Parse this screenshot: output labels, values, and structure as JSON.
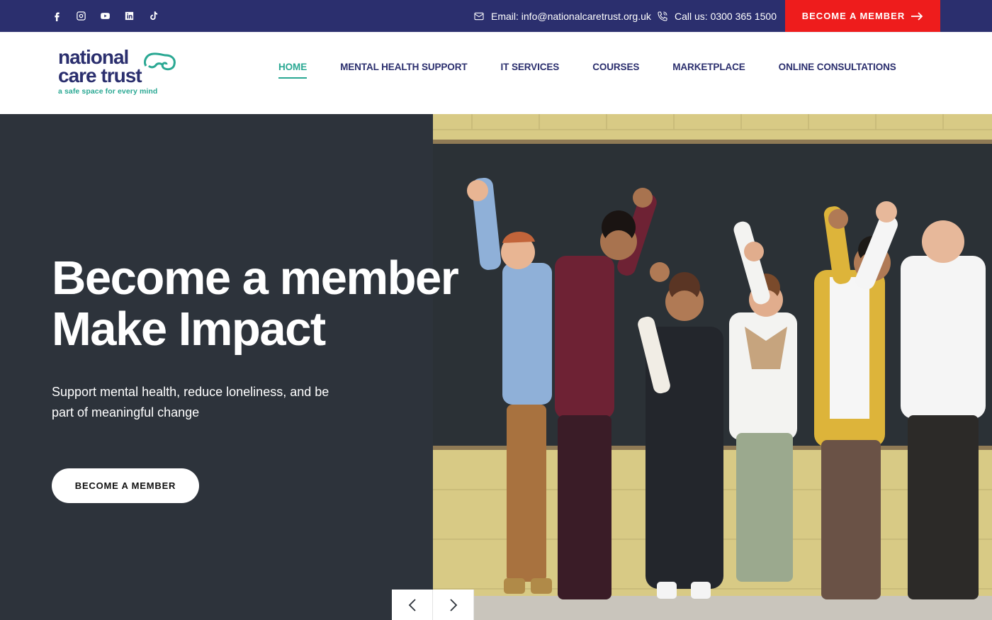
{
  "colors": {
    "topbar_bg": "#2b2f6e",
    "cta_red": "#ee1c1c",
    "accent_teal": "#2aa893",
    "hero_bg": "#2d333b"
  },
  "topbar": {
    "social_icons": [
      "facebook-icon",
      "instagram-icon",
      "youtube-icon",
      "linkedin-icon",
      "tiktok-icon"
    ],
    "email_text": "Email: info@nationalcaretrust.org.uk",
    "phone_text": "Call us: 0300 365 1500",
    "cta_label": "BECOME A MEMBER"
  },
  "logo": {
    "line1": "national",
    "line2": "care trust",
    "tagline": "a safe space for every mind"
  },
  "nav": {
    "items": [
      {
        "label": "HOME",
        "active": true
      },
      {
        "label": "MENTAL HEALTH SUPPORT",
        "active": false
      },
      {
        "label": "IT SERVICES",
        "active": false
      },
      {
        "label": "COURSES",
        "active": false
      },
      {
        "label": "MARKETPLACE",
        "active": false
      },
      {
        "label": "ONLINE CONSULTATIONS",
        "active": false
      }
    ]
  },
  "hero": {
    "headline_line1": "Become a member",
    "headline_line2": "Make Impact",
    "subtitle": "Support mental health, reduce loneliness, and be part of meaningful change",
    "button_label": "BECOME A MEMBER",
    "image_alt": "group-photo"
  }
}
